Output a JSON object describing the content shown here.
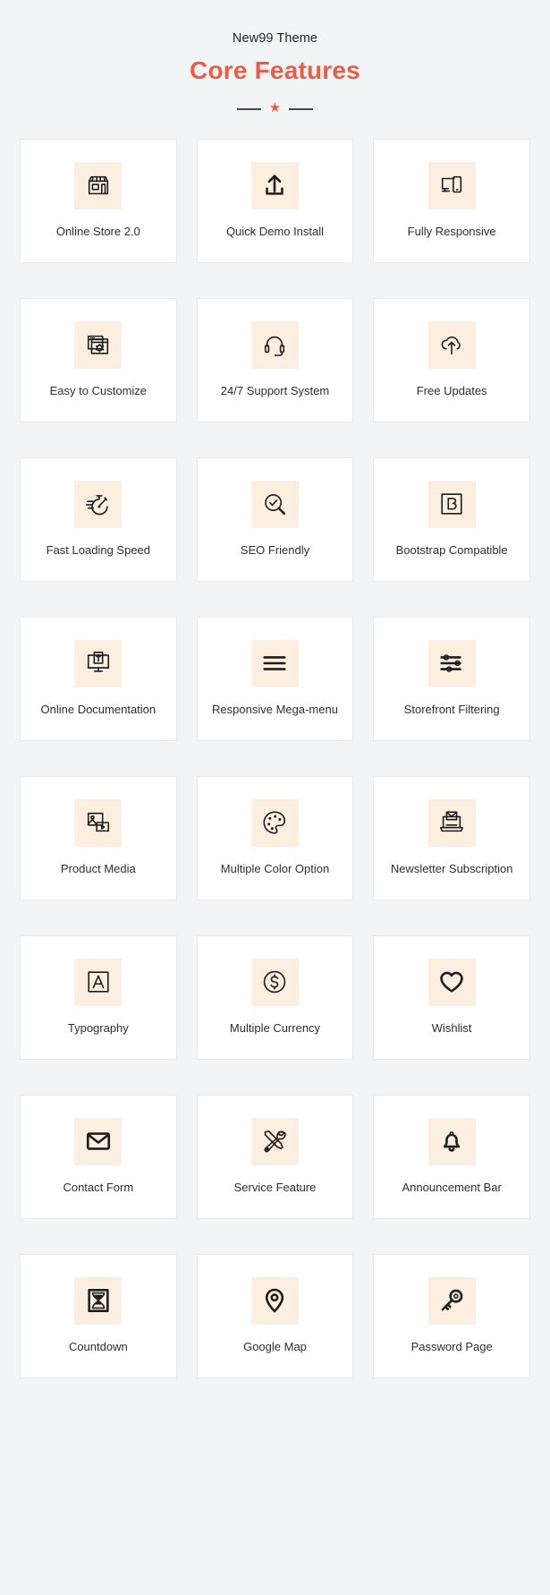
{
  "header": {
    "eyebrow": "New99 Theme",
    "title": "Core Features",
    "divider_star": "★",
    "accent_color": "#ec5b45",
    "background_color": "#f2f5f6",
    "icon_tile_color": "#fcefe0"
  },
  "features": [
    {
      "label": "Online Store 2.0",
      "icon": "storefront-icon"
    },
    {
      "label": "Quick Demo Install",
      "icon": "upload-arrow-icon"
    },
    {
      "label": "Fully Responsive",
      "icon": "monitor-phone-icon"
    },
    {
      "label": "Easy to Customize",
      "icon": "windows-gear-icon"
    },
    {
      "label": "24/7 Support System",
      "icon": "headset-icon"
    },
    {
      "label": "Free Updates",
      "icon": "cloud-upload-icon"
    },
    {
      "label": "Fast Loading Speed",
      "icon": "stopwatch-icon"
    },
    {
      "label": "SEO Friendly",
      "icon": "magnifier-check-icon"
    },
    {
      "label": "Bootstrap Compatible",
      "icon": "bootstrap-b-icon"
    },
    {
      "label": "Online Documentation",
      "icon": "monitor-document-upload-icon"
    },
    {
      "label": "Responsive Mega-menu",
      "icon": "hamburger-menu-icon"
    },
    {
      "label": "Storefront Filtering",
      "icon": "sliders-filter-icon"
    },
    {
      "label": "Product Media",
      "icon": "image-video-icon"
    },
    {
      "label": "Multiple Color Option",
      "icon": "palette-icon"
    },
    {
      "label": "Newsletter Subscription",
      "icon": "laptop-envelope-icon"
    },
    {
      "label": "Typography",
      "icon": "letter-a-box-icon"
    },
    {
      "label": "Multiple Currency",
      "icon": "dollar-coin-icon"
    },
    {
      "label": "Wishlist",
      "icon": "heart-icon"
    },
    {
      "label": "Contact Form",
      "icon": "envelope-icon"
    },
    {
      "label": "Service Feature",
      "icon": "wrench-screwdriver-icon"
    },
    {
      "label": "Announcement Bar",
      "icon": "bell-icon"
    },
    {
      "label": "Countdown",
      "icon": "hourglass-icon"
    },
    {
      "label": "Google Map",
      "icon": "map-pin-icon"
    },
    {
      "label": "Password Page",
      "icon": "key-icon"
    }
  ]
}
